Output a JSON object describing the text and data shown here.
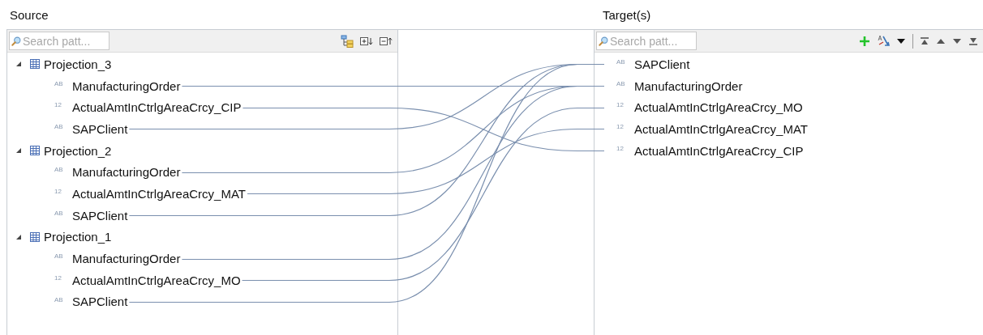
{
  "source": {
    "title": "Source",
    "search": {
      "placeholder": "Search patt..."
    },
    "nodes": [
      {
        "label": "Projection_3",
        "expanded": true,
        "children": [
          {
            "type": "AB",
            "label": "ManufacturingOrder"
          },
          {
            "type": "12",
            "label": "ActualAmtInCtrlgAreaCrcy_CIP"
          },
          {
            "type": "AB",
            "label": "SAPClient"
          }
        ]
      },
      {
        "label": "Projection_2",
        "expanded": true,
        "children": [
          {
            "type": "AB",
            "label": "ManufacturingOrder"
          },
          {
            "type": "12",
            "label": "ActualAmtInCtrlgAreaCrcy_MAT"
          },
          {
            "type": "AB",
            "label": "SAPClient"
          }
        ]
      },
      {
        "label": "Projection_1",
        "expanded": true,
        "children": [
          {
            "type": "AB",
            "label": "ManufacturingOrder"
          },
          {
            "type": "12",
            "label": "ActualAmtInCtrlgAreaCrcy_MO"
          },
          {
            "type": "AB",
            "label": "SAPClient"
          }
        ]
      }
    ]
  },
  "target": {
    "title": "Target(s)",
    "search": {
      "placeholder": "Search patt..."
    },
    "fields": [
      {
        "type": "AB",
        "label": "SAPClient"
      },
      {
        "type": "AB",
        "label": "ManufacturingOrder"
      },
      {
        "type": "12",
        "label": "ActualAmtInCtrlgAreaCrcy_MO"
      },
      {
        "type": "12",
        "label": "ActualAmtInCtrlgAreaCrcy_MAT"
      },
      {
        "type": "12",
        "label": "ActualAmtInCtrlgAreaCrcy_CIP"
      }
    ]
  }
}
